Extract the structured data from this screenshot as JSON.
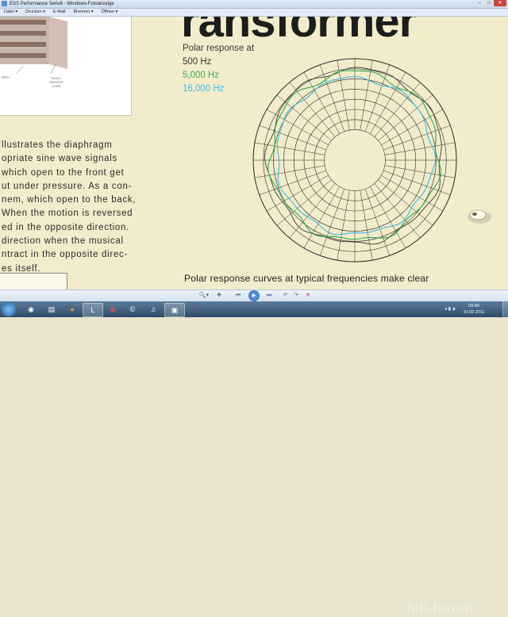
{
  "window": {
    "title": "ESS Performance Serie8 - Windows-Fotoanzeige",
    "buttons": [
      "–",
      "□",
      "✕"
    ]
  },
  "menu": {
    "items": [
      "Datei ▾",
      "Drucken ▾",
      "E-Mail",
      "Brennen ▾",
      "Öffnen ▾"
    ]
  },
  "document": {
    "heading": "ransformer",
    "caption_left": "PATH",
    "caption_right": "MULTI-GROOVE LENS",
    "legend": {
      "line1": "Polar response at",
      "line2": "500 Hz",
      "line3": "5,000 Hz",
      "line4": "16,000 Hz"
    },
    "body_lines": [
      "llustrates the diaphragm",
      "opriate sine wave signals",
      " which open to the front get",
      "ut under pressure. As a con-",
      "nem, which open to the back,",
      "When the motion is reversed",
      "ed in the opposite direction.",
      "direction when the musical",
      "ntract in the opposite direc-",
      "es itself."
    ],
    "bottom_text": "Polar response curves at typical frequencies make clear",
    "colors": {
      "page_bg": "#f2ecca",
      "curve_500": "#3a3a3a",
      "curve_5000": "#2fa84a",
      "curve_16000": "#3bb8e6"
    }
  },
  "controls": {
    "buttons": [
      "🔍▾",
      "✥",
      "⏮",
      "▶",
      "⏭",
      "↶",
      "↷",
      "✕"
    ]
  },
  "taskbar": {
    "apps": [
      "start-orb",
      "IE",
      "Ex",
      "Fx",
      "Lx",
      "CR",
      "C",
      "Q",
      "Fo",
      "Pd"
    ],
    "clock_time": "09:49",
    "clock_date": "10.02.2011",
    "watermark": "hifi-forum"
  }
}
